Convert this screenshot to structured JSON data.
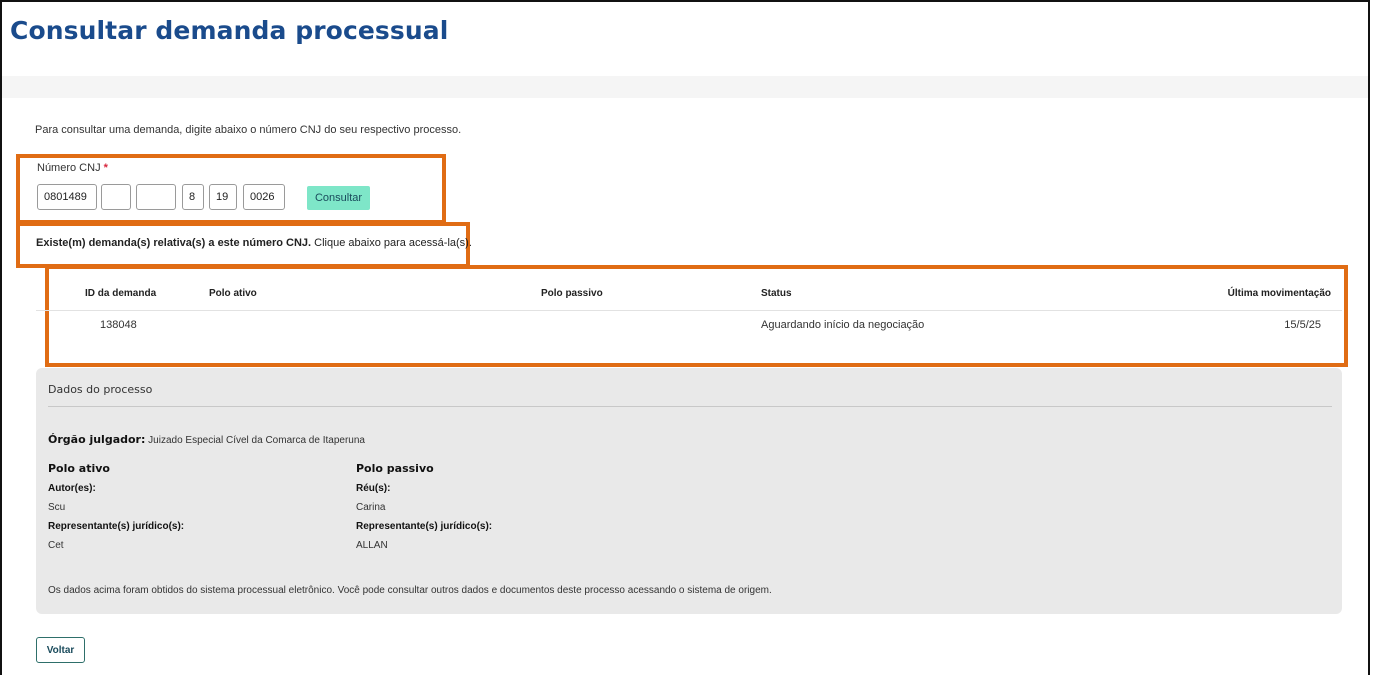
{
  "page": {
    "title": "Consultar demanda processual",
    "intro": "Para consultar uma demanda, digite abaixo o número CNJ do seu respectivo processo."
  },
  "cnj": {
    "label": "Número CNJ",
    "required_mark": "*",
    "segments": [
      "0801489",
      "",
      "",
      "8",
      "19",
      "0026"
    ],
    "submit_label": "Consultar"
  },
  "notice": {
    "bold": "Existe(m) demanda(s) relativa(s) a este número CNJ.",
    "rest": " Clique abaixo para acessá-la(s)."
  },
  "table": {
    "headers": [
      "ID da demanda",
      "Polo ativo",
      "Polo passivo",
      "Status",
      "Última movimentação"
    ],
    "rows": [
      {
        "id": "138048",
        "polo_ativo": "",
        "polo_passivo": "",
        "status": "Aguardando início da negociação",
        "last": "15/5/25"
      }
    ]
  },
  "process": {
    "title": "Dados do processo",
    "orgao_label": "Órgão julgador:",
    "orgao_value": " Juizado Especial Cível da Comarca de Itaperuna",
    "ativo": {
      "heading": "Polo ativo",
      "authors_label": "Autor(es):",
      "authors_value": "Scu",
      "rep_label": "Representante(s) jurídico(s):",
      "rep_value": "Cet"
    },
    "passivo": {
      "heading": "Polo passivo",
      "defendants_label": "Réu(s):",
      "defendants_value": "Carina",
      "rep_label": "Representante(s) jurídico(s):",
      "rep_value": "ALLAN"
    },
    "footnote": "Os dados acima foram obtidos do sistema processual eletrônico. Você pode consultar outros dados e documentos deste processo acessando o sistema de origem."
  },
  "actions": {
    "back_label": "Voltar"
  },
  "colors": {
    "title": "#1a4b8c",
    "highlight": "#e06c14",
    "primary_button": "#7ee6c8",
    "panel": "#e9e9e9"
  }
}
